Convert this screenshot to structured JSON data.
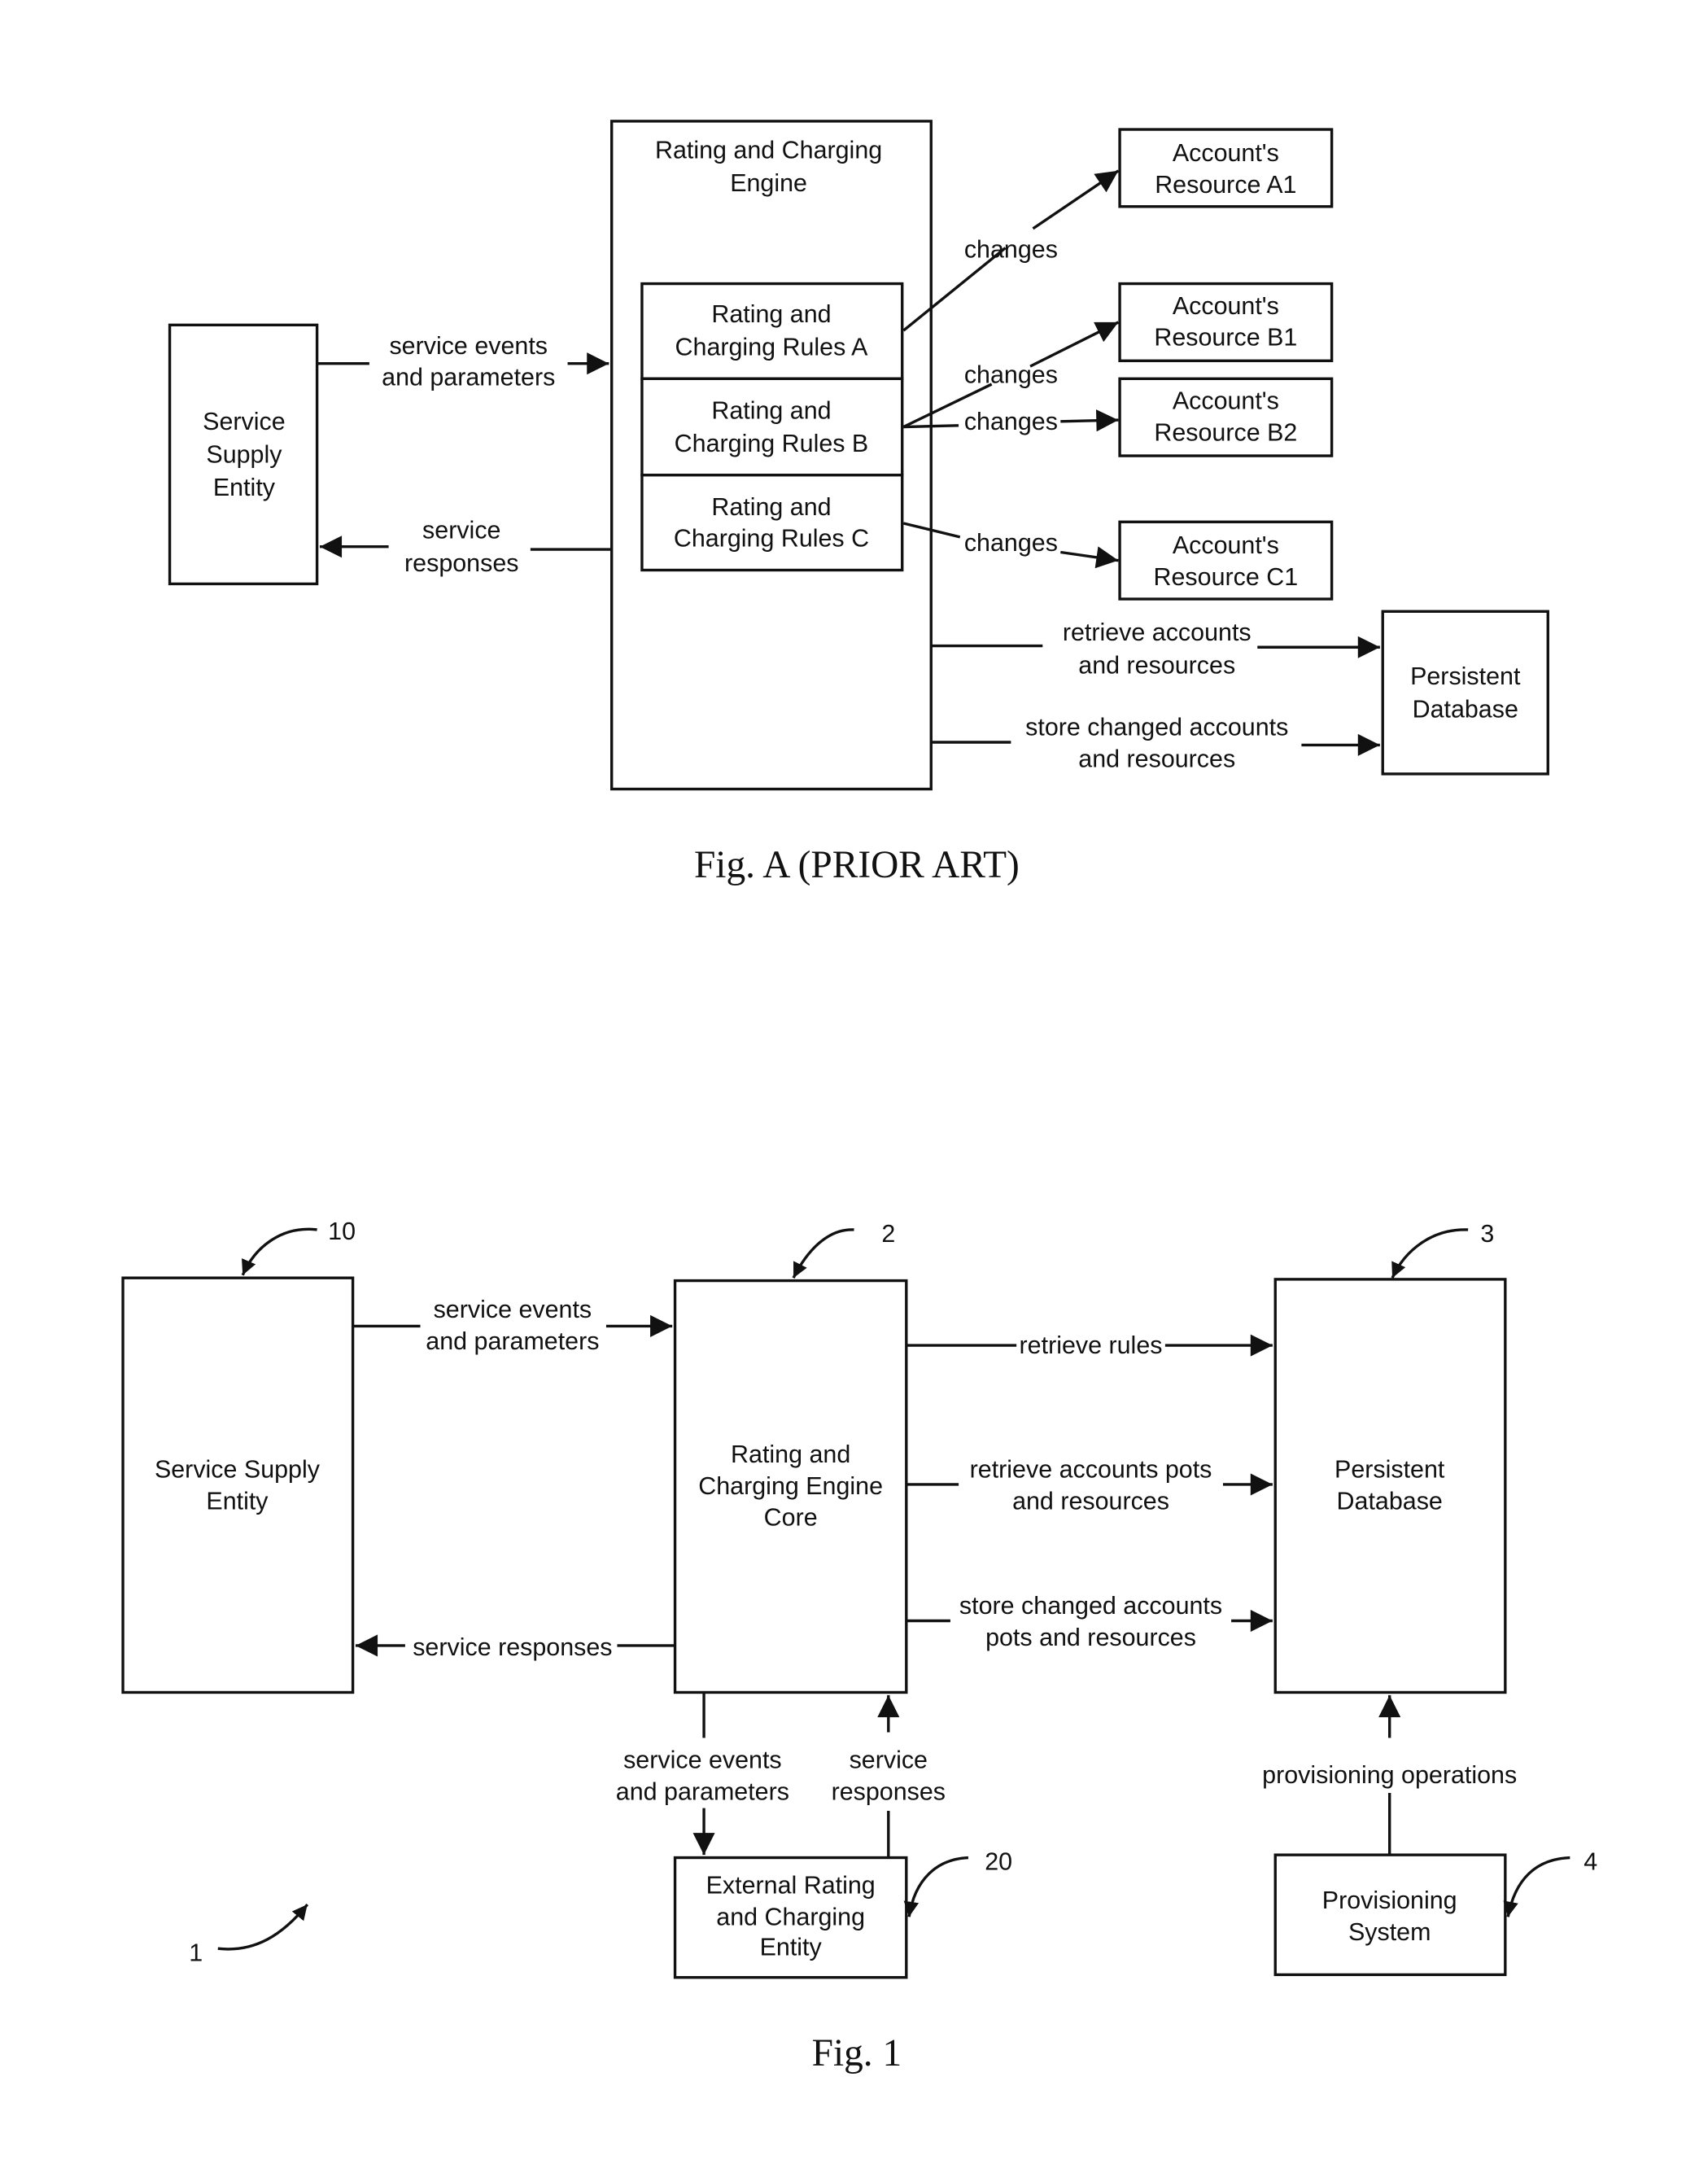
{
  "figA": {
    "caption": "Fig. A (PRIOR ART)",
    "service_supply": [
      "Service",
      "Supply",
      "Entity"
    ],
    "engine": [
      "Rating and Charging",
      "Engine"
    ],
    "rules": [
      [
        "Rating and",
        "Charging Rules A"
      ],
      [
        "Rating and",
        "Charging Rules B"
      ],
      [
        "Rating and",
        "Charging Rules C"
      ]
    ],
    "resources": [
      [
        "Account's",
        "Resource A1"
      ],
      [
        "Account's",
        "Resource B1"
      ],
      [
        "Account's",
        "Resource B2"
      ],
      [
        "Account's",
        "Resource C1"
      ]
    ],
    "changes_label": "changes",
    "db": [
      "Persistent",
      "Database"
    ],
    "events": [
      "service events",
      "and parameters"
    ],
    "responses": [
      "service",
      "responses"
    ],
    "retrieve": [
      "retrieve accounts",
      "and resources"
    ],
    "store": [
      "store changed accounts",
      "and resources"
    ]
  },
  "fig1": {
    "caption": "Fig. 1",
    "service_supply": [
      "Service Supply",
      "Entity"
    ],
    "core": [
      "Rating and",
      "Charging Engine",
      "Core"
    ],
    "db": [
      "Persistent",
      "Database"
    ],
    "external": [
      "External Rating",
      "and Charging",
      "Entity"
    ],
    "provisioning": [
      "Provisioning",
      "System"
    ],
    "events": [
      "service events",
      "and parameters"
    ],
    "responses": "service responses",
    "retrieve_rules": "retrieve rules",
    "retrieve_pots": [
      "retrieve accounts pots",
      "and resources"
    ],
    "store_pots": [
      "store changed accounts",
      "pots and resources"
    ],
    "ext_events": [
      "service events",
      "and parameters"
    ],
    "ext_responses": [
      "service",
      "responses"
    ],
    "prov_ops": "provisioning operations",
    "refs": {
      "system": "1",
      "core": "2",
      "db": "3",
      "prov": "4",
      "sse": "10",
      "ext": "20"
    }
  }
}
